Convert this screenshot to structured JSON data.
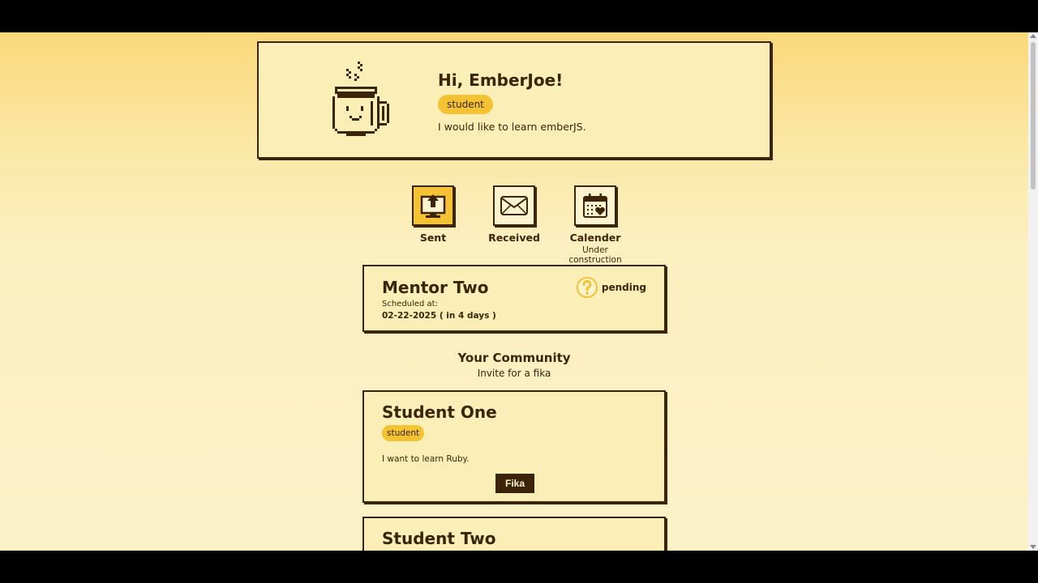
{
  "profile": {
    "greeting": "Hi, EmberJoe!",
    "role": "student",
    "description": "I would like to learn emberJS."
  },
  "nav": [
    {
      "label": "Sent",
      "icon": "upload-monitor-icon",
      "active": true,
      "sublabel": ""
    },
    {
      "label": "Received",
      "icon": "envelope-icon",
      "active": false,
      "sublabel": ""
    },
    {
      "label": "Calender",
      "icon": "calendar-heart-icon",
      "active": false,
      "sublabel": "Under construction"
    }
  ],
  "fika": {
    "name": "Mentor Two",
    "scheduled_label": "Scheduled at:",
    "date": "02-22-2025 ( in 4 days )",
    "status": "pending",
    "status_icon": "question-icon"
  },
  "community": {
    "title": "Your Community",
    "subtitle": "Invite for a fika",
    "members": [
      {
        "name": "Student One",
        "role": "student",
        "description": "I want to learn Ruby.",
        "button": "Fika"
      },
      {
        "name": "Student Two"
      }
    ]
  },
  "colors": {
    "accent": "#f4c232",
    "ink": "#3b2407",
    "card": "#fbefb7"
  }
}
